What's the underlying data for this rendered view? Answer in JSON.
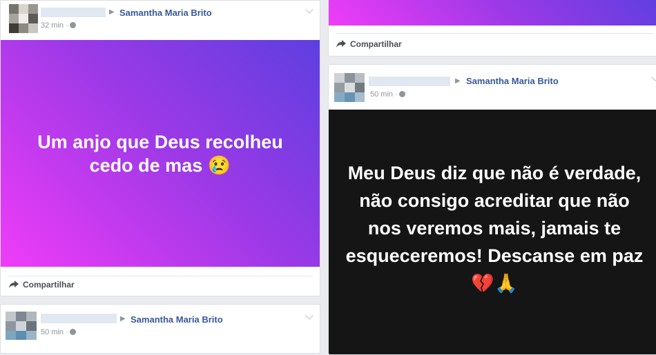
{
  "posts": [
    {
      "target_name": "Samantha Maria Brito",
      "time": "32 min ·",
      "text": "Um anjo que Deus recolheu cedo de mas 😢",
      "share_label": "Compartilhar"
    },
    {
      "target_name": "Samantha Maria Brito",
      "time": "50 min ·"
    },
    {
      "share_label": "Compartilhar"
    },
    {
      "target_name": "Samantha Maria Brito",
      "time": "50 min ·",
      "text": "Meu Deus diz que não é verdade, não consigo acreditar que não nos veremos mais, jamais te esqueceremos! Descanse em paz 💔🙏"
    }
  ],
  "colors": {
    "page_bg": "#e9ebee",
    "link_blue": "#365899",
    "meta_gray": "#90949c",
    "gradient_start": "#f03cf8",
    "gradient_end": "#5e3fe0",
    "dark_post_bg": "#151515"
  },
  "icons": [
    "share-arrow-icon",
    "globe-icon",
    "chevron-down-icon",
    "play-arrow-icon"
  ]
}
